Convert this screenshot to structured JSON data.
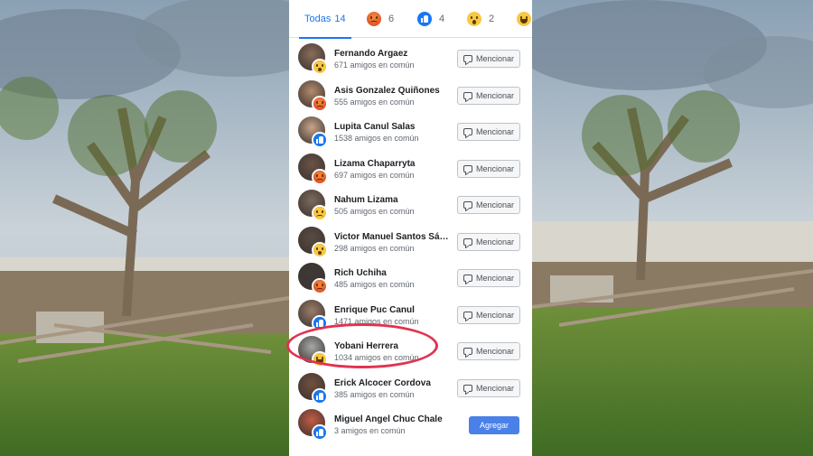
{
  "tabs": {
    "all": {
      "label": "Todas",
      "count": "14"
    },
    "reactions": [
      {
        "icon": "angry-reaction-icon",
        "count": "6"
      },
      {
        "icon": "like-reaction-icon",
        "count": "4"
      },
      {
        "icon": "wow-reaction-icon",
        "count": "2"
      },
      {
        "icon": "haha-reaction-icon",
        "count": ""
      }
    ]
  },
  "people": [
    {
      "name": "Fernando Argaez",
      "mutual": "671 amigos en común",
      "reaction": "wow",
      "action": "Mencionar"
    },
    {
      "name": "Asis Gonzalez Quiñones",
      "mutual": "555 amigos en común",
      "reaction": "angry",
      "action": "Mencionar"
    },
    {
      "name": "Lupita Canul Salas",
      "mutual": "1538 amigos en común",
      "reaction": "like",
      "action": "Mencionar"
    },
    {
      "name": "Lizama Chaparryta",
      "mutual": "697 amigos en común",
      "reaction": "angry",
      "action": "Mencionar"
    },
    {
      "name": "Nahum Lizama",
      "mutual": "505 amigos en común",
      "reaction": "sad",
      "action": "Mencionar"
    },
    {
      "name": "Victor Manuel Santos Sánc...",
      "mutual": "298 amigos en común",
      "reaction": "wow",
      "action": "Mencionar"
    },
    {
      "name": "Rich Uchiha",
      "mutual": "485 amigos en común",
      "reaction": "angry",
      "action": "Mencionar"
    },
    {
      "name": "Enrique Puc Canul",
      "mutual": "1471 amigos en común",
      "reaction": "like",
      "action": "Mencionar"
    },
    {
      "name": "Yobani Herrera",
      "mutual": "1034 amigos en común",
      "reaction": "haha",
      "action": "Mencionar"
    },
    {
      "name": "Erick Alcocer Cordova",
      "mutual": "385 amigos en común",
      "reaction": "like",
      "action": "Mencionar"
    },
    {
      "name": "Miguel Angel Chuc Chale",
      "mutual": "3 amigos en común",
      "reaction": "like",
      "action": "Agregar"
    }
  ],
  "colors": {
    "accent": "#1877f2",
    "highlight": "#e2324f",
    "add_button": "#4a81e8"
  }
}
